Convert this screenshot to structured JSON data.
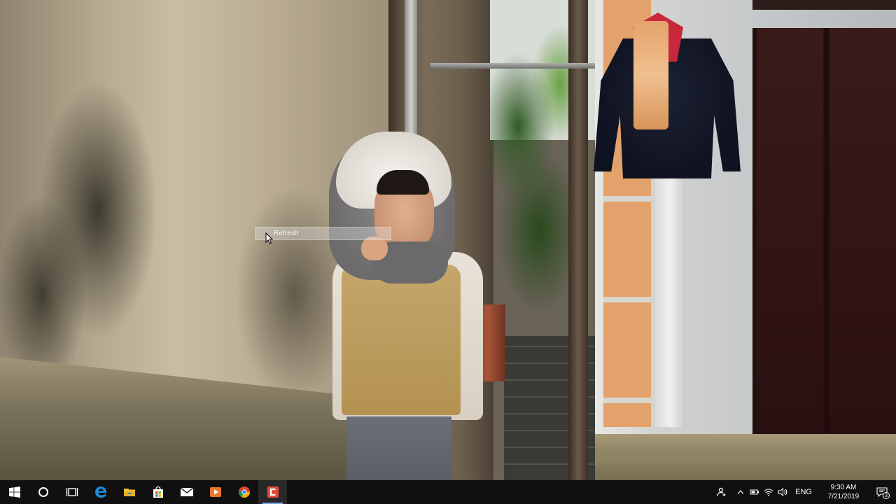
{
  "desktop": {
    "wallpaper": "photo of a child in a fur hood standing in an alley",
    "context_menu": {
      "items": [
        {
          "label": "Refresh"
        }
      ]
    }
  },
  "taskbar": {
    "apps": [
      {
        "name": "start",
        "icon": "windows-logo-icon"
      },
      {
        "name": "search",
        "icon": "cortana-circle-icon"
      },
      {
        "name": "task-view",
        "icon": "task-view-icon"
      },
      {
        "name": "edge",
        "icon": "edge-icon"
      },
      {
        "name": "file-explorer",
        "icon": "folder-icon"
      },
      {
        "name": "store",
        "icon": "store-bag-icon"
      },
      {
        "name": "mail",
        "icon": "mail-icon"
      },
      {
        "name": "media-player",
        "icon": "media-play-icon"
      },
      {
        "name": "chrome",
        "icon": "chrome-icon"
      },
      {
        "name": "camtasia",
        "icon": "camtasia-icon",
        "active": true
      }
    ],
    "tray": {
      "language": "ENG",
      "time": "9:30 AM",
      "date": "7/21/2019",
      "notification_count": "3"
    }
  },
  "colors": {
    "taskbar_bg": "#101010",
    "edge_blue": "#1f8ad8",
    "folder_yellow": "#f2c341",
    "chrome_red": "#db4437",
    "chrome_green": "#0f9d58",
    "chrome_yellow": "#f4b400",
    "camtasia_red": "#e04b3a",
    "media_orange": "#e8782a"
  }
}
